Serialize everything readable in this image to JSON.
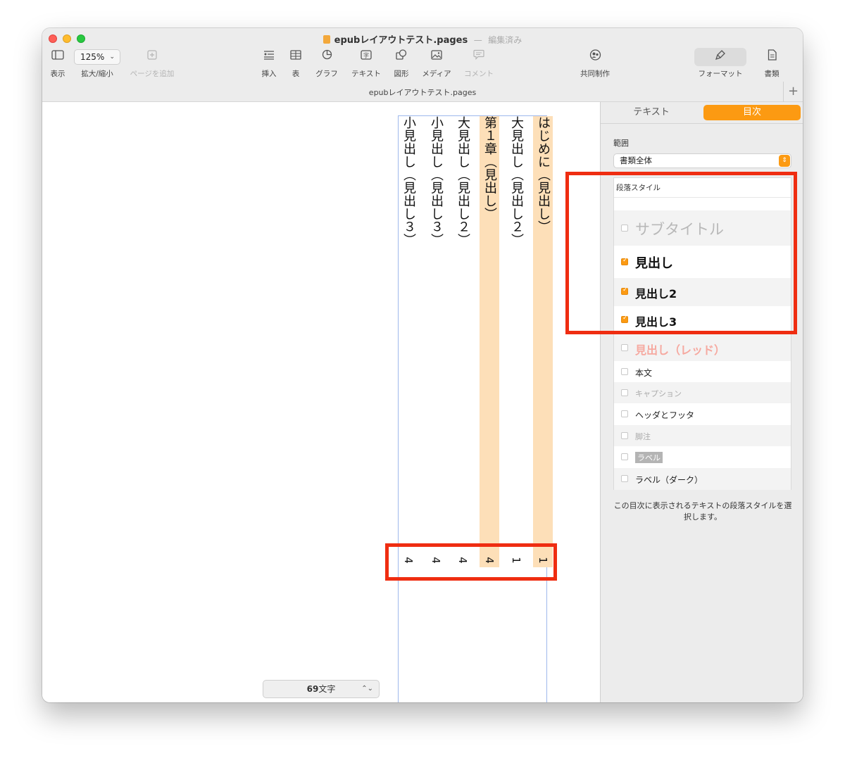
{
  "window": {
    "title": "epubレイアウトテスト.pages",
    "separator": "—",
    "status": "編集済み",
    "doc_tab": "epubレイアウトテスト.pages",
    "plus": "+"
  },
  "toolbar": {
    "view": "表示",
    "zoom_value": "125%",
    "zoom_label": "拡大/縮小",
    "add_page": "ページを追加",
    "insert": "挿入",
    "table": "表",
    "chart": "グラフ",
    "text": "テキスト",
    "shape": "図形",
    "media": "メディア",
    "comment": "コメント",
    "collaborate": "共同制作",
    "format": "フォーマット",
    "document": "書類"
  },
  "toc": {
    "entries": [
      {
        "title": "はじめに（見出し）",
        "page": "1",
        "highlight": true
      },
      {
        "title": "大見出し（見出し２）",
        "page": "1",
        "highlight": false
      },
      {
        "title": "第１章（見出し）",
        "page": "4",
        "highlight": true
      },
      {
        "title": "大見出し（見出し２）",
        "page": "4",
        "highlight": false
      },
      {
        "title": "小見出し（見出し３）",
        "page": "4",
        "highlight": false
      },
      {
        "title": "小見出し（見出し３）",
        "page": "4",
        "highlight": false
      }
    ]
  },
  "word_count": {
    "number": "69",
    "unit": "文字"
  },
  "sidebar": {
    "tabs": [
      {
        "label": "テキスト",
        "active": false
      },
      {
        "label": "目次",
        "active": true
      }
    ],
    "range_label": "範囲",
    "range_value": "書類全体",
    "styles_header": "段落スタイル",
    "styles": [
      {
        "label": "サブタイトル",
        "checked": false
      },
      {
        "label": "見出し",
        "checked": true
      },
      {
        "label": "見出し2",
        "checked": true
      },
      {
        "label": "見出し3",
        "checked": true
      },
      {
        "label": "見出し（レッド）",
        "checked": false
      },
      {
        "label": "本文",
        "checked": false
      },
      {
        "label": "キャプション",
        "checked": false
      },
      {
        "label": "ヘッダとフッタ",
        "checked": false
      },
      {
        "label": "脚注",
        "checked": false
      },
      {
        "label": "ラベル",
        "checked": false
      },
      {
        "label": "ラベル（ダーク）",
        "checked": false
      }
    ],
    "hint": "この目次に表示されるテキストの段落スタイルを選択します。"
  },
  "colors": {
    "accent": "#fc9a12",
    "highlight": "#fddfb8",
    "annotation_red": "#ef2d11"
  }
}
